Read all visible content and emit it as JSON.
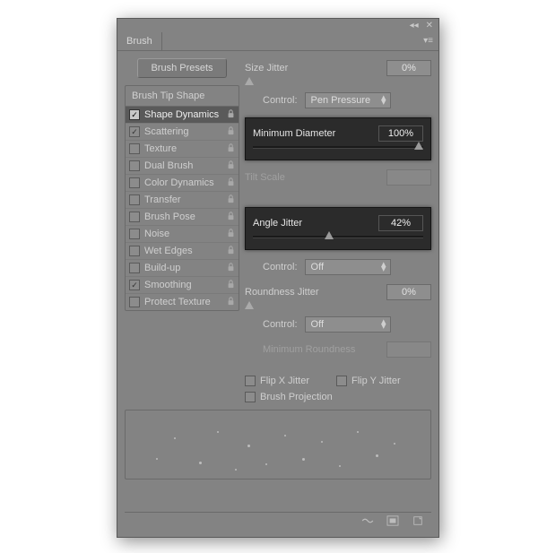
{
  "panel": {
    "title": "Brush"
  },
  "presets_button": "Brush Presets",
  "options_header": "Brush Tip Shape",
  "options": [
    {
      "label": "Shape Dynamics",
      "checked": true,
      "locked": true,
      "selected": true
    },
    {
      "label": "Scattering",
      "checked": true,
      "locked": true,
      "selected": false
    },
    {
      "label": "Texture",
      "checked": false,
      "locked": true,
      "selected": false
    },
    {
      "label": "Dual Brush",
      "checked": false,
      "locked": true,
      "selected": false
    },
    {
      "label": "Color Dynamics",
      "checked": false,
      "locked": true,
      "selected": false
    },
    {
      "label": "Transfer",
      "checked": false,
      "locked": true,
      "selected": false
    },
    {
      "label": "Brush Pose",
      "checked": false,
      "locked": true,
      "selected": false
    },
    {
      "label": "Noise",
      "checked": false,
      "locked": true,
      "selected": false
    },
    {
      "label": "Wet Edges",
      "checked": false,
      "locked": true,
      "selected": false
    },
    {
      "label": "Build-up",
      "checked": false,
      "locked": true,
      "selected": false
    },
    {
      "label": "Smoothing",
      "checked": true,
      "locked": true,
      "selected": false
    },
    {
      "label": "Protect Texture",
      "checked": false,
      "locked": true,
      "selected": false
    }
  ],
  "size_jitter": {
    "label": "Size Jitter",
    "value": "0%",
    "control_label": "Control:",
    "control_value": "Pen Pressure"
  },
  "min_diameter": {
    "label": "Minimum Diameter",
    "value": "100%"
  },
  "tilt_scale": {
    "label": "Tilt Scale",
    "value": ""
  },
  "angle_jitter": {
    "label": "Angle Jitter",
    "value": "42%",
    "control_label": "Control:",
    "control_value": "Off"
  },
  "roundness_jitter": {
    "label": "Roundness Jitter",
    "value": "0%",
    "control_label": "Control:",
    "control_value": "Off"
  },
  "min_roundness": {
    "label": "Minimum Roundness",
    "value": ""
  },
  "flip_x": {
    "label": "Flip X Jitter",
    "checked": false
  },
  "flip_y": {
    "label": "Flip Y Jitter",
    "checked": false
  },
  "brush_projection": {
    "label": "Brush Projection",
    "checked": false
  }
}
